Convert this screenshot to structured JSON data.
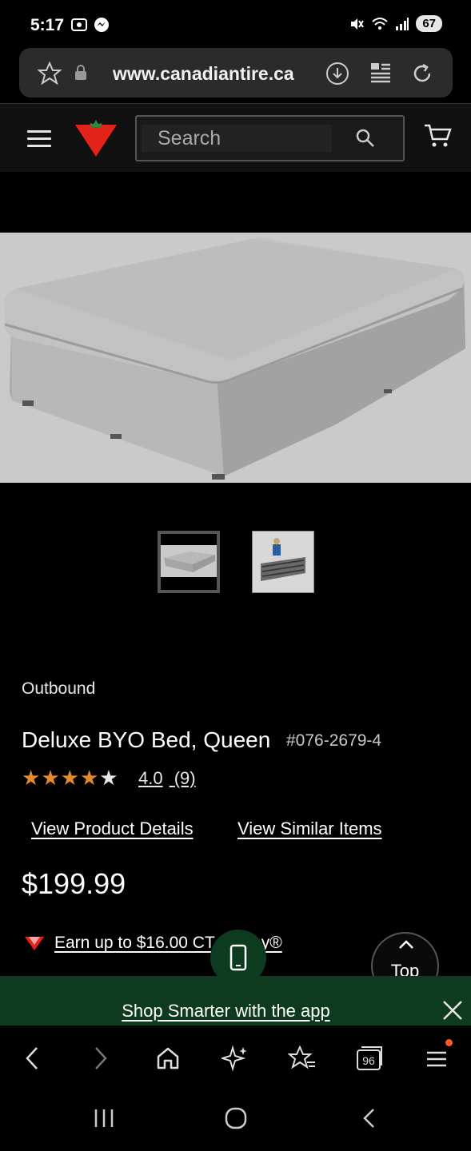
{
  "status_bar": {
    "time": "5:17",
    "battery": "67"
  },
  "browser": {
    "url": "www.canadiantire.ca",
    "tab_count": "96"
  },
  "header": {
    "search_placeholder": "Search"
  },
  "product": {
    "brand": "Outbound",
    "title": "Deluxe BYO Bed, Queen",
    "sku": "#076-2679-4",
    "rating_value": "4.0",
    "rating_count": "(9)",
    "stars_filled": 4,
    "stars_total": 5,
    "view_details_label": "View Product Details",
    "view_similar_label": "View Similar Items",
    "price": "$199.99",
    "earn_text": "Earn up to $16.00 CT Money®",
    "thumbnail_count": 2,
    "active_thumbnail": 1
  },
  "floating": {
    "top_label": "Top"
  },
  "app_banner": {
    "text": "Shop Smarter with the app"
  },
  "colors": {
    "brand_red": "#e2231a",
    "star_orange": "#e6892a",
    "banner_green": "#0e3b1f"
  }
}
